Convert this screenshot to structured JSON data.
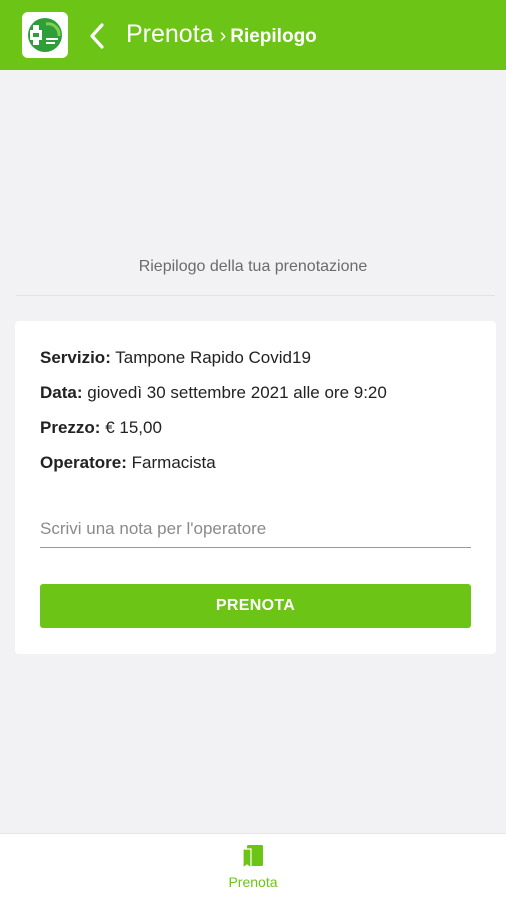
{
  "colors": {
    "accent": "#6cc417",
    "background": "#f2f2f5",
    "card": "#ffffff"
  },
  "header": {
    "logo_icon": "pharmacy-cross-logo",
    "back_icon": "chevron-left-icon",
    "title": "Prenota",
    "separator": "›",
    "breadcrumb": "Riepilogo"
  },
  "summary": {
    "heading": "Riepilogo della tua prenotazione",
    "rows": [
      {
        "label": "Servizio:",
        "value": "Tampone Rapido Covid19"
      },
      {
        "label": "Data:",
        "value": "giovedì 30 settembre 2021 alle ore 9:20"
      },
      {
        "label": "Prezzo:",
        "value": "€ 15,00"
      },
      {
        "label": "Operatore:",
        "value": "Farmacista"
      }
    ],
    "note_placeholder": "Scrivi una nota per l'operatore",
    "note_value": "",
    "book_button": "PRENOTA"
  },
  "bottom_nav": {
    "items": [
      {
        "label": "Prenota",
        "icon": "bookmark-book-icon",
        "active": true
      }
    ]
  }
}
